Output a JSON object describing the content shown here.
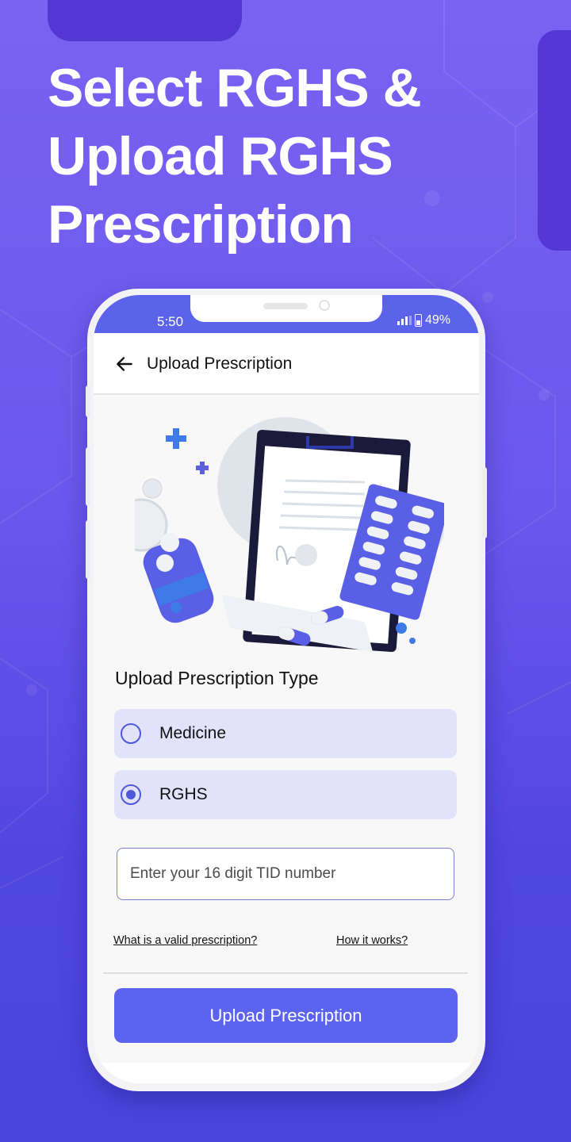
{
  "promo": {
    "headline_lines": [
      "Select RGHS  &",
      "Upload RGHS",
      "Prescription"
    ]
  },
  "status_bar": {
    "time": "5:50",
    "battery": "49%",
    "signal_icon": "signal-bars-icon",
    "battery_icon": "battery-icon"
  },
  "app_bar": {
    "back_icon": "arrow-left-icon",
    "title": "Upload Prescription"
  },
  "illustration": {
    "description": "prescription-clipboard-with-pills-illustration"
  },
  "form": {
    "section_title": "Upload Prescription Type",
    "options": [
      {
        "label": "Medicine",
        "selected": false
      },
      {
        "label": "RGHS",
        "selected": true
      }
    ],
    "tid_input": {
      "value": "",
      "placeholder": "Enter your 16 digit TID number"
    },
    "links": {
      "valid_prescription": "What is a valid prescription?",
      "how_it_works": "How it works?"
    },
    "submit_label": "Upload Prescription"
  },
  "colors": {
    "background": "#7a62f2",
    "accent": "#5b63ef",
    "status_bar": "#5b63ea",
    "option_bg": "#e2e3fb",
    "radio": "#4f58d8"
  }
}
